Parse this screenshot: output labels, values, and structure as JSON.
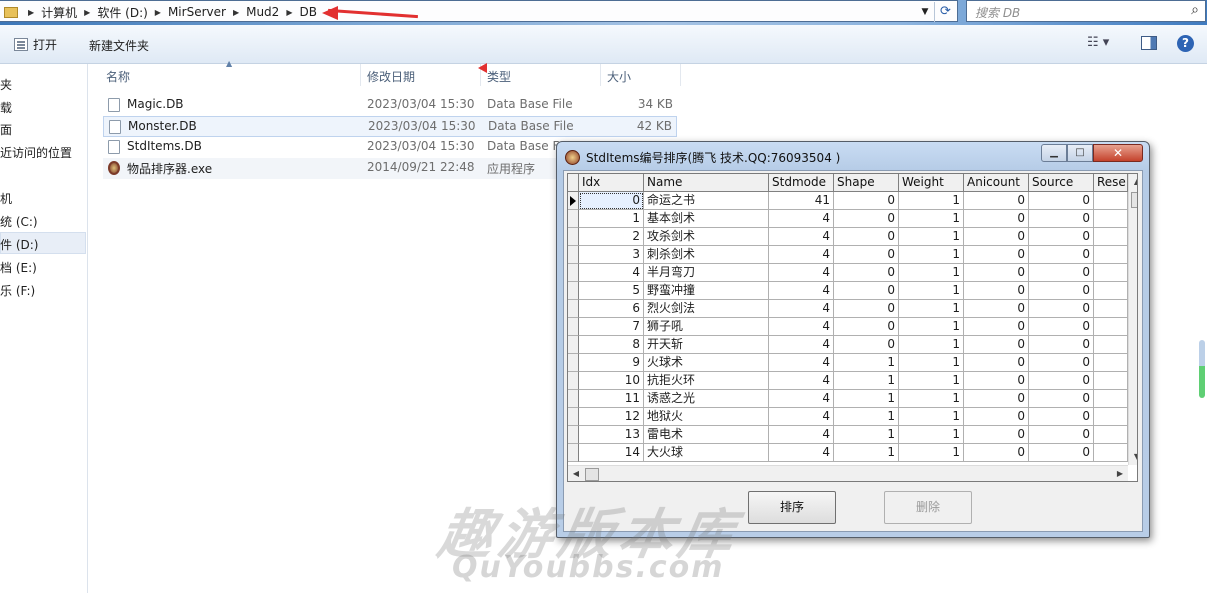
{
  "breadcrumb": [
    "计算机",
    "软件 (D:)",
    "MirServer",
    "Mud2",
    "DB"
  ],
  "search": {
    "placeholder": "搜索 DB"
  },
  "toolbar": {
    "open_label": "打开",
    "new_folder_label": "新建文件夹"
  },
  "nav": {
    "items": [
      "夹",
      "载",
      "面",
      "近访问的位置",
      "机",
      "统 (C:)",
      "件 (D:)",
      "档 (E:)",
      "乐 (F:)"
    ]
  },
  "columns": {
    "name": "名称",
    "date": "修改日期",
    "type": "类型",
    "size": "大小"
  },
  "files": [
    {
      "name": "Magic.DB",
      "date": "2023/03/04 15:30",
      "type": "Data Base File",
      "size": "34 KB"
    },
    {
      "name": "Monster.DB",
      "date": "2023/03/04 15:30",
      "type": "Data Base File",
      "size": "42 KB"
    },
    {
      "name": "StdItems.DB",
      "date": "2023/03/04 15:30",
      "type": "Data Base F",
      "size": ""
    },
    {
      "name": "物品排序器.exe",
      "date": "2014/09/21 22:48",
      "type": "应用程序",
      "size": ""
    }
  ],
  "dialog": {
    "title": "StdItems编号排序(腾飞  技术.QQ:76093504 )",
    "sort_button": "排序",
    "delete_button": "删除",
    "headers": [
      "Idx",
      "Name",
      "Stdmode",
      "Shape",
      "Weight",
      "Anicount",
      "Source",
      "Rese"
    ],
    "rows": [
      [
        "0",
        "命运之书",
        "41",
        "0",
        "1",
        "0",
        "0"
      ],
      [
        "1",
        "基本剑术",
        "4",
        "0",
        "1",
        "0",
        "0"
      ],
      [
        "2",
        "攻杀剑术",
        "4",
        "0",
        "1",
        "0",
        "0"
      ],
      [
        "3",
        "刺杀剑术",
        "4",
        "0",
        "1",
        "0",
        "0"
      ],
      [
        "4",
        "半月弯刀",
        "4",
        "0",
        "1",
        "0",
        "0"
      ],
      [
        "5",
        "野蛮冲撞",
        "4",
        "0",
        "1",
        "0",
        "0"
      ],
      [
        "6",
        "烈火剑法",
        "4",
        "0",
        "1",
        "0",
        "0"
      ],
      [
        "7",
        "狮子吼",
        "4",
        "0",
        "1",
        "0",
        "0"
      ],
      [
        "8",
        "开天斩",
        "4",
        "0",
        "1",
        "0",
        "0"
      ],
      [
        "9",
        "火球术",
        "4",
        "1",
        "1",
        "0",
        "0"
      ],
      [
        "10",
        "抗拒火环",
        "4",
        "1",
        "1",
        "0",
        "0"
      ],
      [
        "11",
        "诱惑之光",
        "4",
        "1",
        "1",
        "0",
        "0"
      ],
      [
        "12",
        "地狱火",
        "4",
        "1",
        "1",
        "0",
        "0"
      ],
      [
        "13",
        "雷电术",
        "4",
        "1",
        "1",
        "0",
        "0"
      ],
      [
        "14",
        "大火球",
        "4",
        "1",
        "1",
        "0",
        "0"
      ]
    ]
  },
  "watermark": {
    "line1": "趣游版本库",
    "line2": "QuYoubbs.com"
  }
}
